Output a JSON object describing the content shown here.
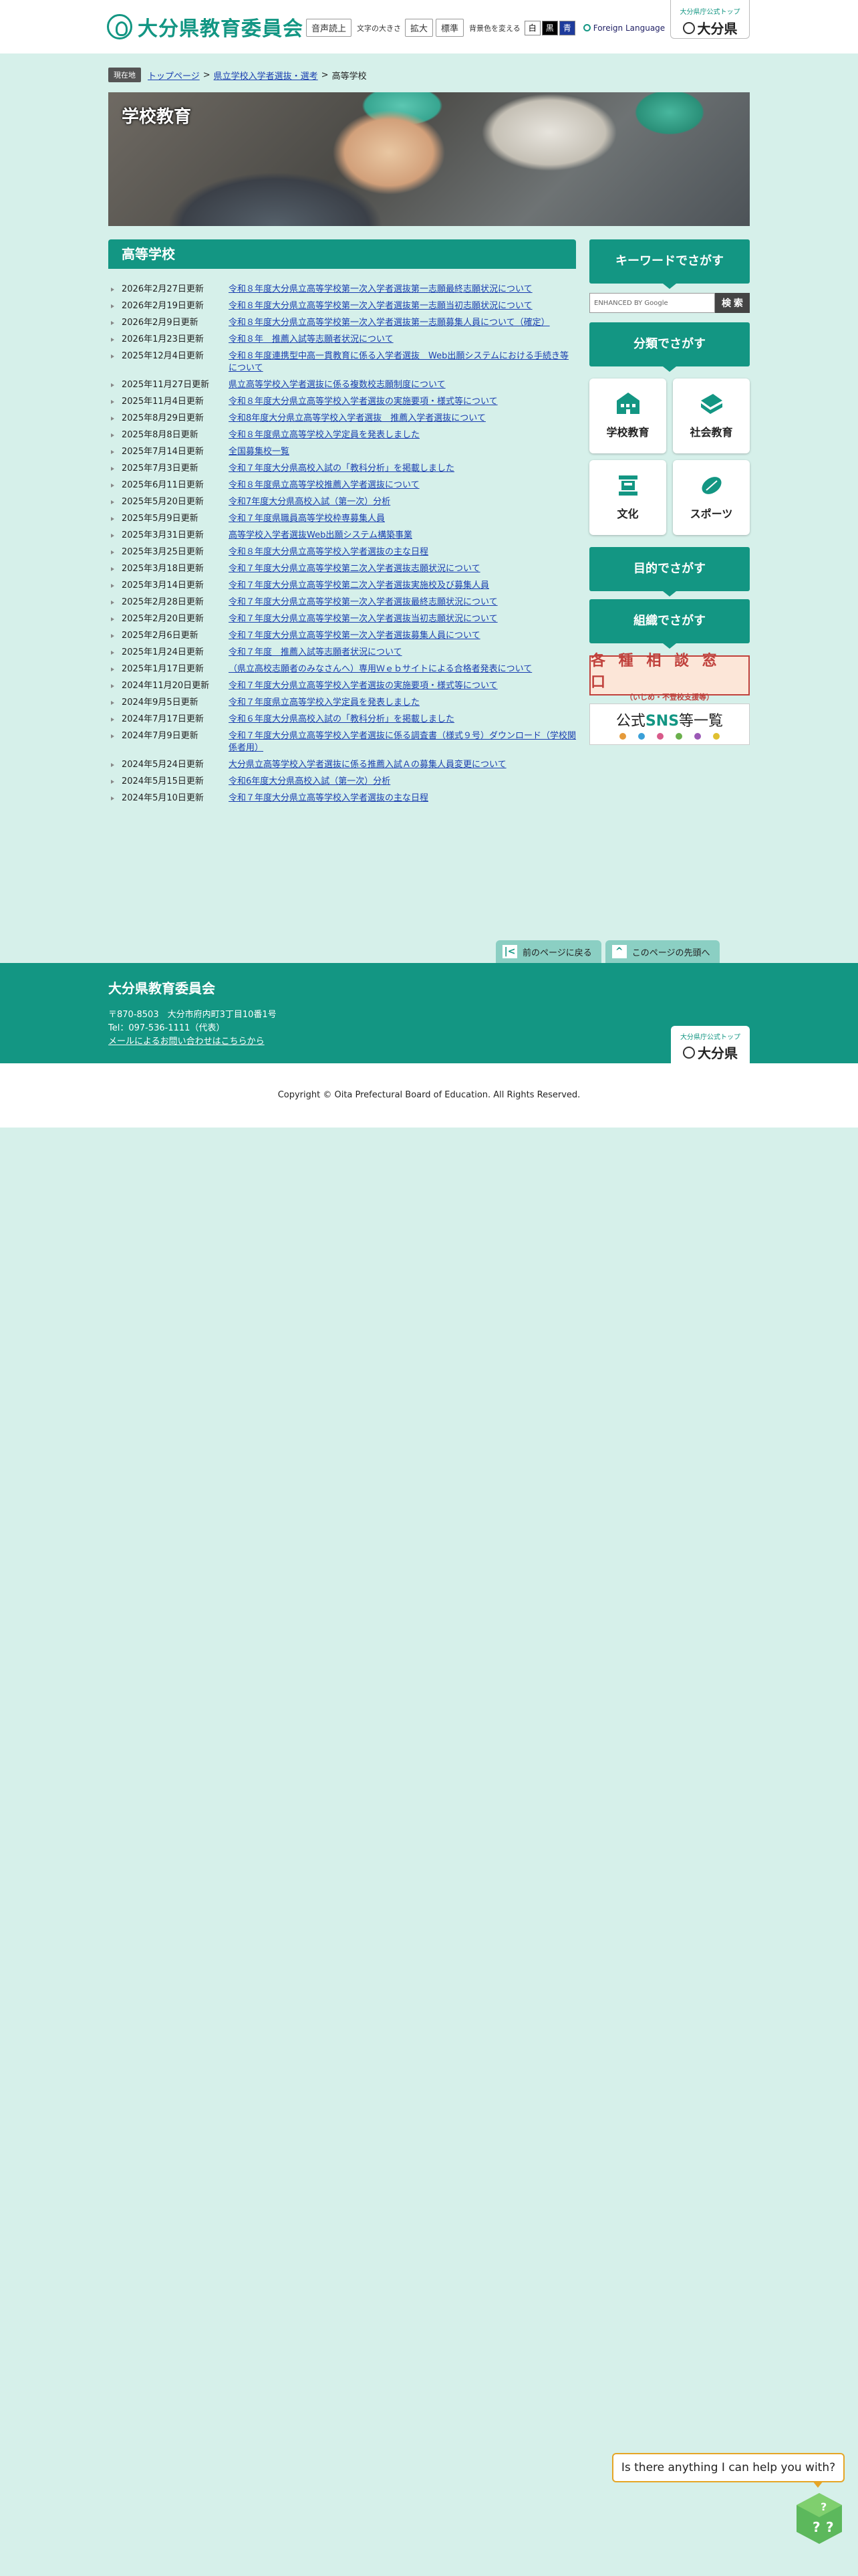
{
  "header": {
    "logo_text": "大分県教育委員会",
    "voice_button": "音声読上",
    "font_size_label": "文字の大きさ",
    "font_enlarge": "拡大",
    "font_standard": "標準",
    "bg_color_label": "背景色を変える",
    "bg_white": "白",
    "bg_black": "黒",
    "bg_blue": "青",
    "foreign_language": "Foreign Language",
    "pref_top_small": "大分県庁公式トップ",
    "pref_top_big": "大分県"
  },
  "breadcrumb": {
    "here": "現在地",
    "items": [
      "トップページ",
      "県立学校入学者選抜・選考"
    ],
    "current": "高等学校"
  },
  "banner": {
    "title": "学校教育"
  },
  "main": {
    "title": "高等学校",
    "news": [
      {
        "date": "2026年2月27日更新",
        "title": "令和８年度大分県立高等学校第一次入学者選抜第一志願最終志願状況について"
      },
      {
        "date": "2026年2月19日更新",
        "title": "令和８年度大分県立高等学校第一次入学者選抜第一志願当初志願状況について"
      },
      {
        "date": "2026年2月9日更新",
        "title": "令和８年度大分県立高等学校第一次入学者選抜第一志願募集人員について（確定）"
      },
      {
        "date": "2026年1月23日更新",
        "title": "令和８年　推薦入試等志願者状況について"
      },
      {
        "date": "2025年12月4日更新",
        "title": "令和８年度連携型中高一貫教育に係る入学者選抜　Web出願システムにおける手続き等について"
      },
      {
        "date": "2025年11月27日更新",
        "title": "県立高等学校入学者選抜に係る複数校志願制度について"
      },
      {
        "date": "2025年11月4日更新",
        "title": "令和８年度大分県立高等学校入学者選抜の実施要項・様式等について"
      },
      {
        "date": "2025年8月29日更新",
        "title": "令和8年度大分県立高等学校入学者選抜　推薦入学者選抜について"
      },
      {
        "date": "2025年8月8日更新",
        "title": "令和８年度県立高等学校入学定員を発表しました"
      },
      {
        "date": "2025年7月14日更新",
        "title": "全国募集校一覧"
      },
      {
        "date": "2025年7月3日更新",
        "title": "令和７年度大分県高校入試の「教科分析」を掲載しました"
      },
      {
        "date": "2025年6月11日更新",
        "title": "令和８年度県立高等学校推薦入学者選抜について"
      },
      {
        "date": "2025年5月20日更新",
        "title": "令和7年度大分県高校入試（第一次）分析"
      },
      {
        "date": "2025年5月9日更新",
        "title": "令和７年度県職員高等学校枠専募集人員"
      },
      {
        "date": "2025年3月31日更新",
        "title": "高等学校入学者選抜Web出願システム構築事業"
      },
      {
        "date": "2025年3月25日更新",
        "title": "令和８年度大分県立高等学校入学者選抜の主な日程"
      },
      {
        "date": "2025年3月18日更新",
        "title": "令和７年度大分県立高等学校第二次入学者選抜志願状況について"
      },
      {
        "date": "2025年3月14日更新",
        "title": "令和７年度大分県立高等学校第二次入学者選抜実施校及び募集人員"
      },
      {
        "date": "2025年2月28日更新",
        "title": "令和７年度大分県立高等学校第一次入学者選抜最終志願状況について"
      },
      {
        "date": "2025年2月20日更新",
        "title": "令和７年度大分県立高等学校第一次入学者選抜当初志願状況について"
      },
      {
        "date": "2025年2月6日更新",
        "title": "令和７年度大分県立高等学校第一次入学者選抜募集人員について"
      },
      {
        "date": "2025年1月24日更新",
        "title": "令和７年度　推薦入試等志願者状況について"
      },
      {
        "date": "2025年1月17日更新",
        "title": "（県立高校志願者のみなさんへ）専用Ｗｅｂサイトによる合格者発表について"
      },
      {
        "date": "2024年11月20日更新",
        "title": "令和７年度大分県立高等学校入学者選抜の実施要項・様式等について"
      },
      {
        "date": "2024年9月5日更新",
        "title": "令和７年度県立高等学校入学定員を発表しました"
      },
      {
        "date": "2024年7月17日更新",
        "title": "令和６年度大分県高校入試の「教科分析」を掲載しました"
      },
      {
        "date": "2024年7月9日更新",
        "title": "令和７年度大分県立高等学校入学者選抜に係る調査書（様式９号）ダウンロード（学校関係者用）"
      },
      {
        "date": "2024年5月24日更新",
        "title": "大分県立高等学校入学者選抜に係る推薦入試Ａの募集人員変更について"
      },
      {
        "date": "2024年5月15日更新",
        "title": "令和6年度大分県高校入試（第一次）分析"
      },
      {
        "date": "2024年5月10日更新",
        "title": "令和７年度大分県立高等学校入学者選抜の主な日程"
      }
    ]
  },
  "sidebar": {
    "keyword_head": "キーワードでさがす",
    "search_placeholder": "ENHANCED BY Google",
    "search_button": "検 索",
    "category_head": "分類でさがす",
    "tiles": [
      "学校教育",
      "社会教育",
      "文化",
      "スポーツ"
    ],
    "purpose_head": "目的でさがす",
    "org_head": "組織でさがす",
    "soudan_main": "各 種 相 談 窓 口",
    "soudan_sub": "（いじめ・不登校支援等）",
    "sns_prefix": "公式",
    "sns_mid": "SNS",
    "sns_suffix": "等一覧"
  },
  "page_nav": {
    "back": "前のページに戻る",
    "top": "このページの先頭へ"
  },
  "footer": {
    "org": "大分県教育委員会",
    "address": "〒870-8503　大分市府内町3丁目10番1号",
    "tel": "Tel：097-536-1111（代表）",
    "mail_link": "メールによるお問い合わせはこちらから",
    "pref_small": "大分県庁公式トップ",
    "pref_big": "大分県",
    "copyright": "Copyright © Oita Prefectural Board of Education. All Rights Reserved."
  },
  "chat": {
    "prompt": "Is there anything I can help you with?"
  },
  "colors": {
    "accent": "#139683",
    "background": "#d6f0ea",
    "link": "#1a3fb0"
  }
}
